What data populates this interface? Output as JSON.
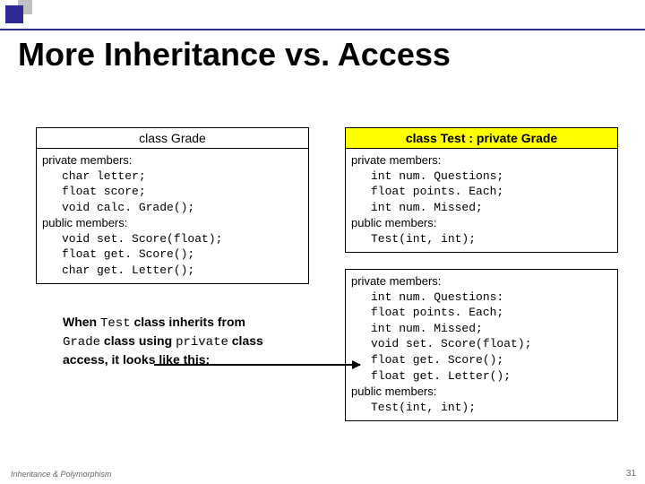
{
  "slide": {
    "title": "More Inheritance vs. Access",
    "footer": "Inheritance & Polymorphism",
    "page": "31"
  },
  "left_box": {
    "header": "class Grade",
    "priv_label": "private members:",
    "priv_lines": [
      "char letter;",
      "float score;",
      "void calc. Grade();"
    ],
    "pub_label": "public members:",
    "pub_lines": [
      "void set. Score(float);",
      "float get. Score();",
      "char get. Letter();"
    ]
  },
  "right_box_top": {
    "header": "class Test : private Grade",
    "priv_label": "private members:",
    "priv_lines": [
      "int num. Questions;",
      "float points. Each;",
      "int num. Missed;"
    ],
    "pub_label": "public members:",
    "pub_lines": [
      "Test(int, int);"
    ]
  },
  "right_box_bottom": {
    "priv_label": "private members:",
    "priv_lines": [
      "int num. Questions:",
      "float points. Each;",
      "int num. Missed;",
      "void set. Score(float);",
      "float get. Score();",
      "float get. Letter();"
    ],
    "pub_label": "public members:",
    "pub_lines": [
      "Test(int, int);"
    ]
  },
  "explain": {
    "t1": "When ",
    "c1": "Test",
    "t2": " class inherits from ",
    "c2": "Grade",
    "t3": " class using ",
    "c3": "private",
    "t4": " class access, it looks like this:"
  }
}
